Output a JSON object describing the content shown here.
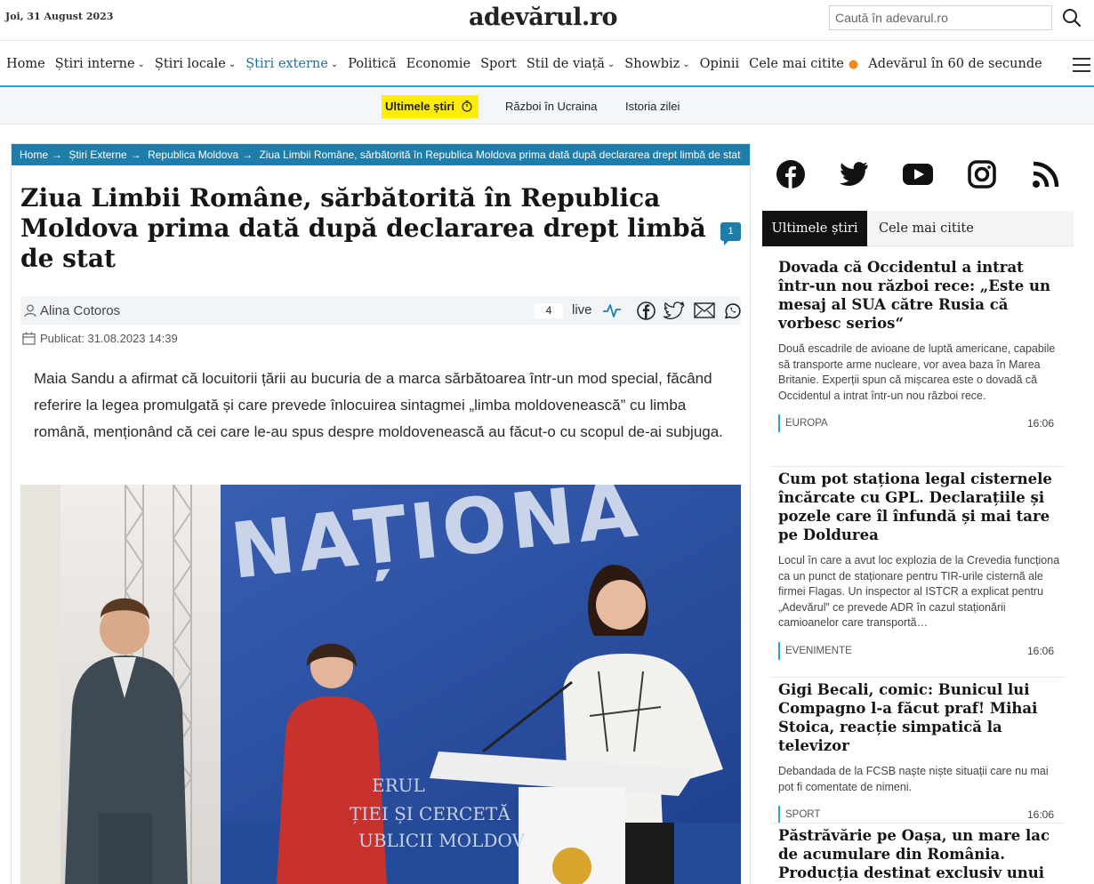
{
  "header": {
    "date": "Joi, 31 August 2023",
    "logo": "adevărul.ro",
    "search": {
      "placeholder": "Caută în adevarul.ro",
      "icon": "search-icon"
    }
  },
  "nav": {
    "items": [
      {
        "label": "Home",
        "dropdown": false
      },
      {
        "label": "Știri interne",
        "dropdown": true
      },
      {
        "label": "Știri locale",
        "dropdown": true
      },
      {
        "label": "Știri externe",
        "dropdown": true,
        "active": true
      },
      {
        "label": "Politică",
        "dropdown": false
      },
      {
        "label": "Economie",
        "dropdown": false
      },
      {
        "label": "Sport",
        "dropdown": false
      },
      {
        "label": "Stil de viață",
        "dropdown": true
      },
      {
        "label": "Showbiz",
        "dropdown": true
      },
      {
        "label": "Opinii",
        "dropdown": false
      },
      {
        "label": "Cele mai citite",
        "dropdown": false,
        "icon": "fire-icon"
      },
      {
        "label": "Adevărul în 60 de secunde",
        "dropdown": false
      }
    ],
    "accent_color": "#2aa6cf"
  },
  "subnav": {
    "ultimele": "Ultimele știri",
    "razboi": "Război în Ucraina",
    "istoria": "Istoria zilei",
    "highlight_color": "#ffee00"
  },
  "article": {
    "breadcrumb": [
      "Home",
      "Știri Externe",
      "Republica Moldova",
      "Ziua Limbii Române, sărbătorită în Republica Moldova prima dată după declararea drept limbă de stat"
    ],
    "title": "Ziua Limbii Române, sărbătorită în Republica Moldova prima dată după declararea drept limbă de stat",
    "comments_count": "1",
    "author": "Alina Cotoros",
    "live_count": "4",
    "live_label": "live",
    "published": "Publicat: 31.08.2023 14:39",
    "lead": "Maia Sandu a afirmat că locuitorii țării au bucuria de a marca sărbătoarea într-un mod special, făcând referire la legea promulgată și care prevede înlocuirea sintagmei „limba moldovenească” cu limba română, menționând că cei care le-au spus despre moldovenească au făcut-o cu scopul de-ai subjuga.",
    "photo": {
      "banner_text": "NAȚIONA",
      "podium_text_1": "ERUL",
      "podium_text_2": "ȚIEI ȘI CERCETĂ",
      "podium_text_3": "UBLICII MOLDOV"
    },
    "brand_color": "#1f7da9"
  },
  "social": [
    "facebook-icon",
    "twitter-icon",
    "youtube-icon",
    "instagram-icon",
    "rss-icon"
  ],
  "sidebar": {
    "tabs": [
      "Ultimele știri",
      "Cele mai citite"
    ],
    "news": [
      {
        "title": "Dovada că Occidentul a intrat într-un nou război rece: „Este un mesaj al SUA către Rusia că vorbesc serios“",
        "desc": "Două escadrile de avioane de luptă americane, capabile să transporte arme nucleare, vor avea baza în Marea Britanie. Experții spun că mișcarea este o dovadă că Occidentul a intrat într-un nou război rece.",
        "category": "EUROPA",
        "time": "16:06"
      },
      {
        "title": "Cum pot staționa legal cisternele încărcate cu GPL. Declarațiile și pozele care îl înfundă și mai tare pe Doldurea",
        "desc": "Locul în care a avut loc explozia de la Crevedia funcționa ca un punct de staționare pentru TIR-urile cisternă ale firmei Flagas. Un inspector al ISTCR a explicat pentru „Adevărul” ce prevede ADR în cazul staționării camioanelor care transportă…",
        "category": "EVENIMENTE",
        "time": "16:06"
      },
      {
        "title": "Gigi Becali, comic: Bunicul lui Compagno l-a făcut praf! Mihai Stoica, reacție simpatică la televizor",
        "desc": "Debandada de la FCSB naște niște situații care nu mai pot fi comentate de nimeni.",
        "category": "SPORT",
        "time": "16:06"
      },
      {
        "title": "Păstrăvărie pe Oașa, un mare lac de acumulare din România. Producția destinat exclusiv unui lanț de",
        "desc": "",
        "category": "",
        "time": ""
      }
    ]
  }
}
